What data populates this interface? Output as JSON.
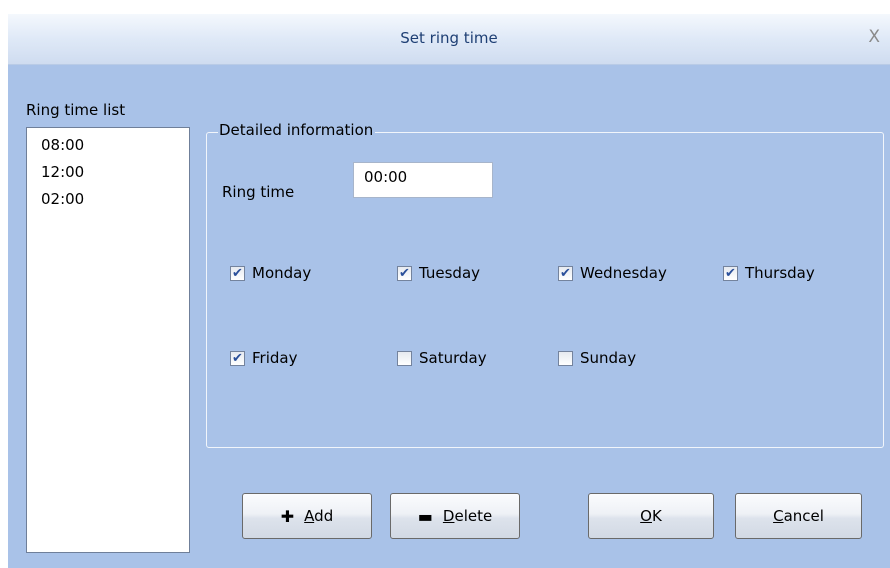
{
  "window": {
    "title": "Set ring time",
    "close": "X"
  },
  "ring_time_list": {
    "label": "Ring time list",
    "items": [
      "08:00",
      "12:00",
      "02:00"
    ]
  },
  "details": {
    "group_label": "Detailed information",
    "ring_time_label": "Ring time",
    "ring_time_value": "00:00"
  },
  "days": [
    {
      "label": "Monday",
      "checked": true
    },
    {
      "label": "Tuesday",
      "checked": true
    },
    {
      "label": "Wednesday",
      "checked": true
    },
    {
      "label": "Thursday",
      "checked": true
    },
    {
      "label": "Friday",
      "checked": true
    },
    {
      "label": "Saturday",
      "checked": false
    },
    {
      "label": "Sunday",
      "checked": false
    }
  ],
  "buttons": {
    "add": {
      "mnemonic": "A",
      "rest": "dd",
      "icon": "plus-icon"
    },
    "delete": {
      "mnemonic": "D",
      "rest": "elete",
      "icon": "minus-icon"
    },
    "ok": {
      "mnemonic": "O",
      "rest": "K"
    },
    "cancel": {
      "mnemonic": "C",
      "rest": "ancel"
    }
  },
  "colors": {
    "client_bg": "#a9c2e8",
    "title_text": "#1e3f74",
    "check": "#2a4f9a"
  }
}
